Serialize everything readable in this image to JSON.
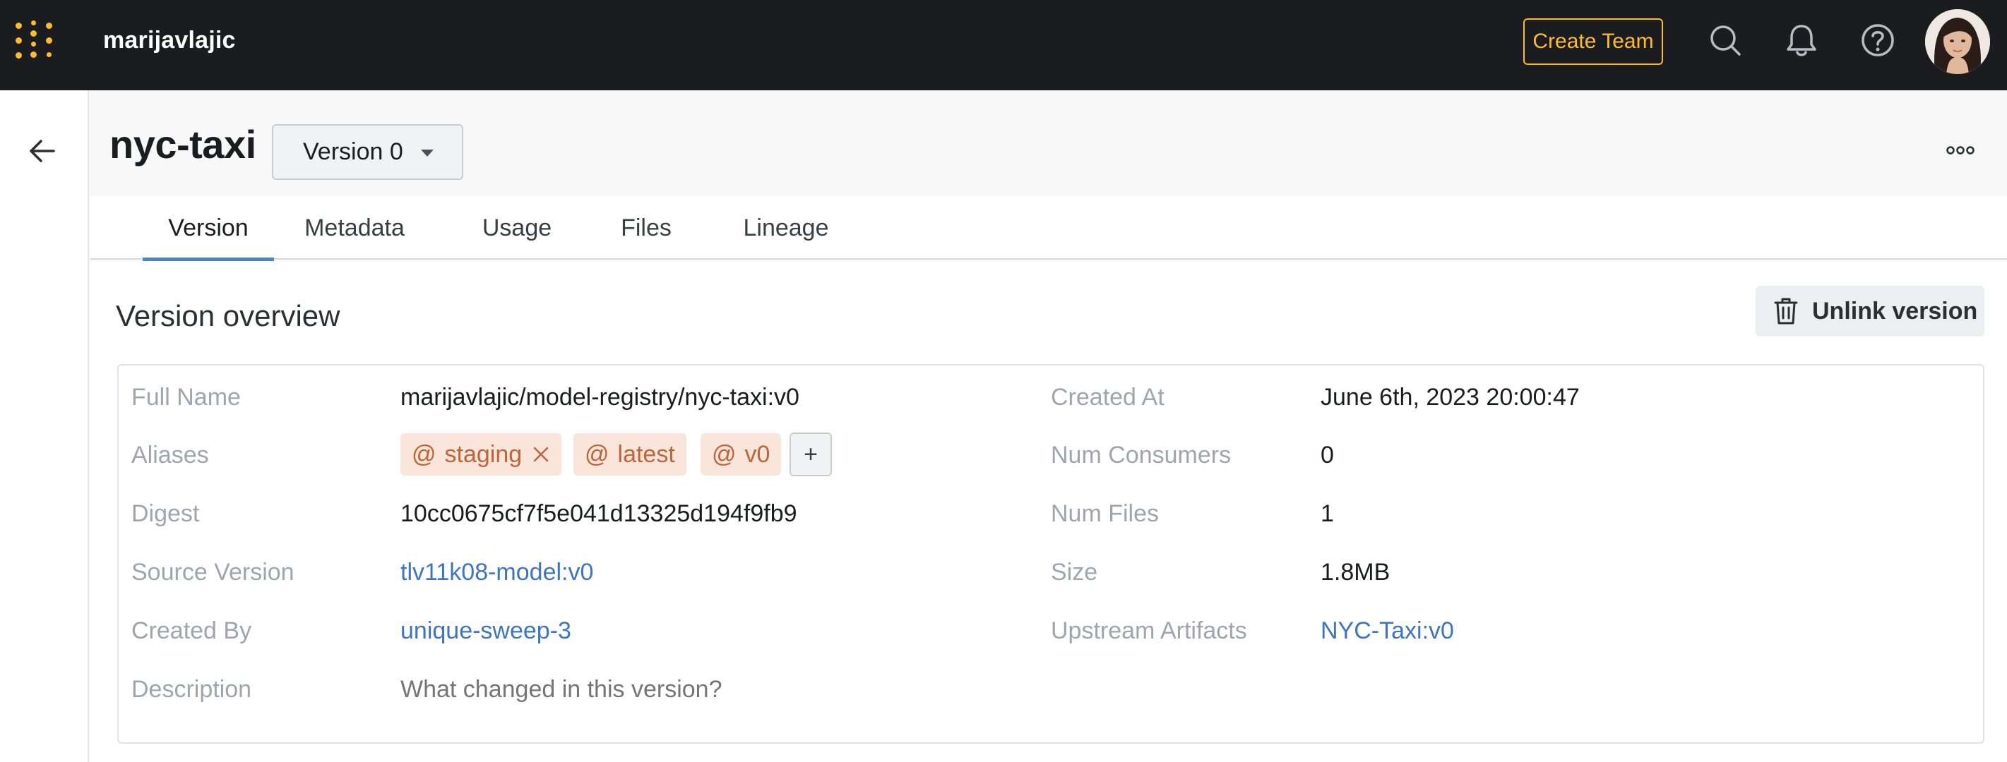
{
  "topbar": {
    "username": "marijavlajic",
    "create_team_label": "Create Team",
    "icons": [
      "logo-icon",
      "search-icon",
      "bell-icon",
      "help-icon",
      "avatar"
    ],
    "accent_color": "#fcbc32"
  },
  "header": {
    "artifact_name": "nyc-taxi",
    "version_select": "Version 0"
  },
  "tabs": [
    {
      "label": "Version",
      "active": true
    },
    {
      "label": "Metadata",
      "active": false
    },
    {
      "label": "Usage",
      "active": false
    },
    {
      "label": "Files",
      "active": false
    },
    {
      "label": "Lineage",
      "active": false
    }
  ],
  "overview": {
    "title": "Version overview",
    "unlink_label": "Unlink version",
    "left_fields": {
      "full_name": {
        "label": "Full Name",
        "value": "marijavlajic/model-registry/nyc-taxi:v0"
      },
      "aliases": {
        "label": "Aliases",
        "tags": [
          "staging",
          "latest",
          "v0"
        ],
        "add_label": "+"
      },
      "digest": {
        "label": "Digest",
        "value": "10cc0675cf7f5e041d13325d194f9fb9"
      },
      "source_version": {
        "label": "Source Version",
        "value": "tlv11k08-model:v0"
      },
      "created_by": {
        "label": "Created By",
        "value": "unique-sweep-3"
      },
      "description": {
        "label": "Description",
        "placeholder": "What changed in this version?"
      }
    },
    "right_fields": {
      "created_at": {
        "label": "Created At",
        "value": "June 6th, 2023 20:00:47"
      },
      "num_consumers": {
        "label": "Num Consumers",
        "value": "0"
      },
      "num_files": {
        "label": "Num Files",
        "value": "1"
      },
      "size": {
        "label": "Size",
        "value": "1.8MB"
      },
      "upstream_artifacts": {
        "label": "Upstream Artifacts",
        "value": "NYC-Taxi:v0"
      }
    },
    "alias_color": "#c0643a",
    "link_color": "#3f74c0"
  }
}
